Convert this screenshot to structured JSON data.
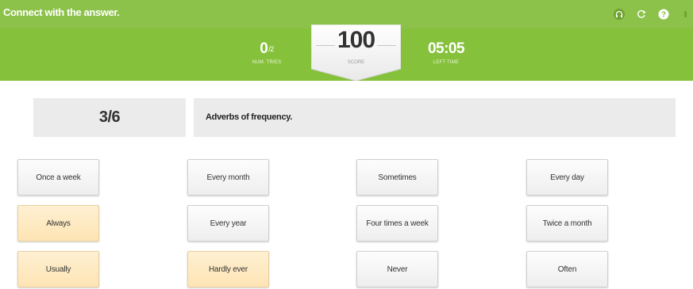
{
  "header": {
    "title": "Connect with the answer.",
    "icons": [
      "headphones-icon",
      "refresh-icon",
      "help-icon"
    ]
  },
  "stats": {
    "tries_value": "0",
    "tries_total": "/2",
    "tries_label": "NUM. TRIES",
    "score_value": "100",
    "score_label": "SCORE",
    "time_value": "05:05",
    "time_label": "LEFT TIME"
  },
  "question": {
    "counter": "3/6",
    "text": "Adverbs of frequency."
  },
  "options": [
    {
      "label": "Once a week",
      "selected": false
    },
    {
      "label": "Every month",
      "selected": false
    },
    {
      "label": "Sometimes",
      "selected": false
    },
    {
      "label": "Every day",
      "selected": false
    },
    {
      "label": "Always",
      "selected": true
    },
    {
      "label": "Every year",
      "selected": false
    },
    {
      "label": "Four times a week",
      "selected": false
    },
    {
      "label": "Twice a month",
      "selected": false
    },
    {
      "label": "Usually",
      "selected": true
    },
    {
      "label": "Hardly ever",
      "selected": true
    },
    {
      "label": "Never",
      "selected": false
    },
    {
      "label": "Often",
      "selected": false
    }
  ],
  "colors": {
    "header_green": "#8cc14a",
    "score_bar_green": "#86c13c",
    "selected_tile": "#fde4b4"
  }
}
